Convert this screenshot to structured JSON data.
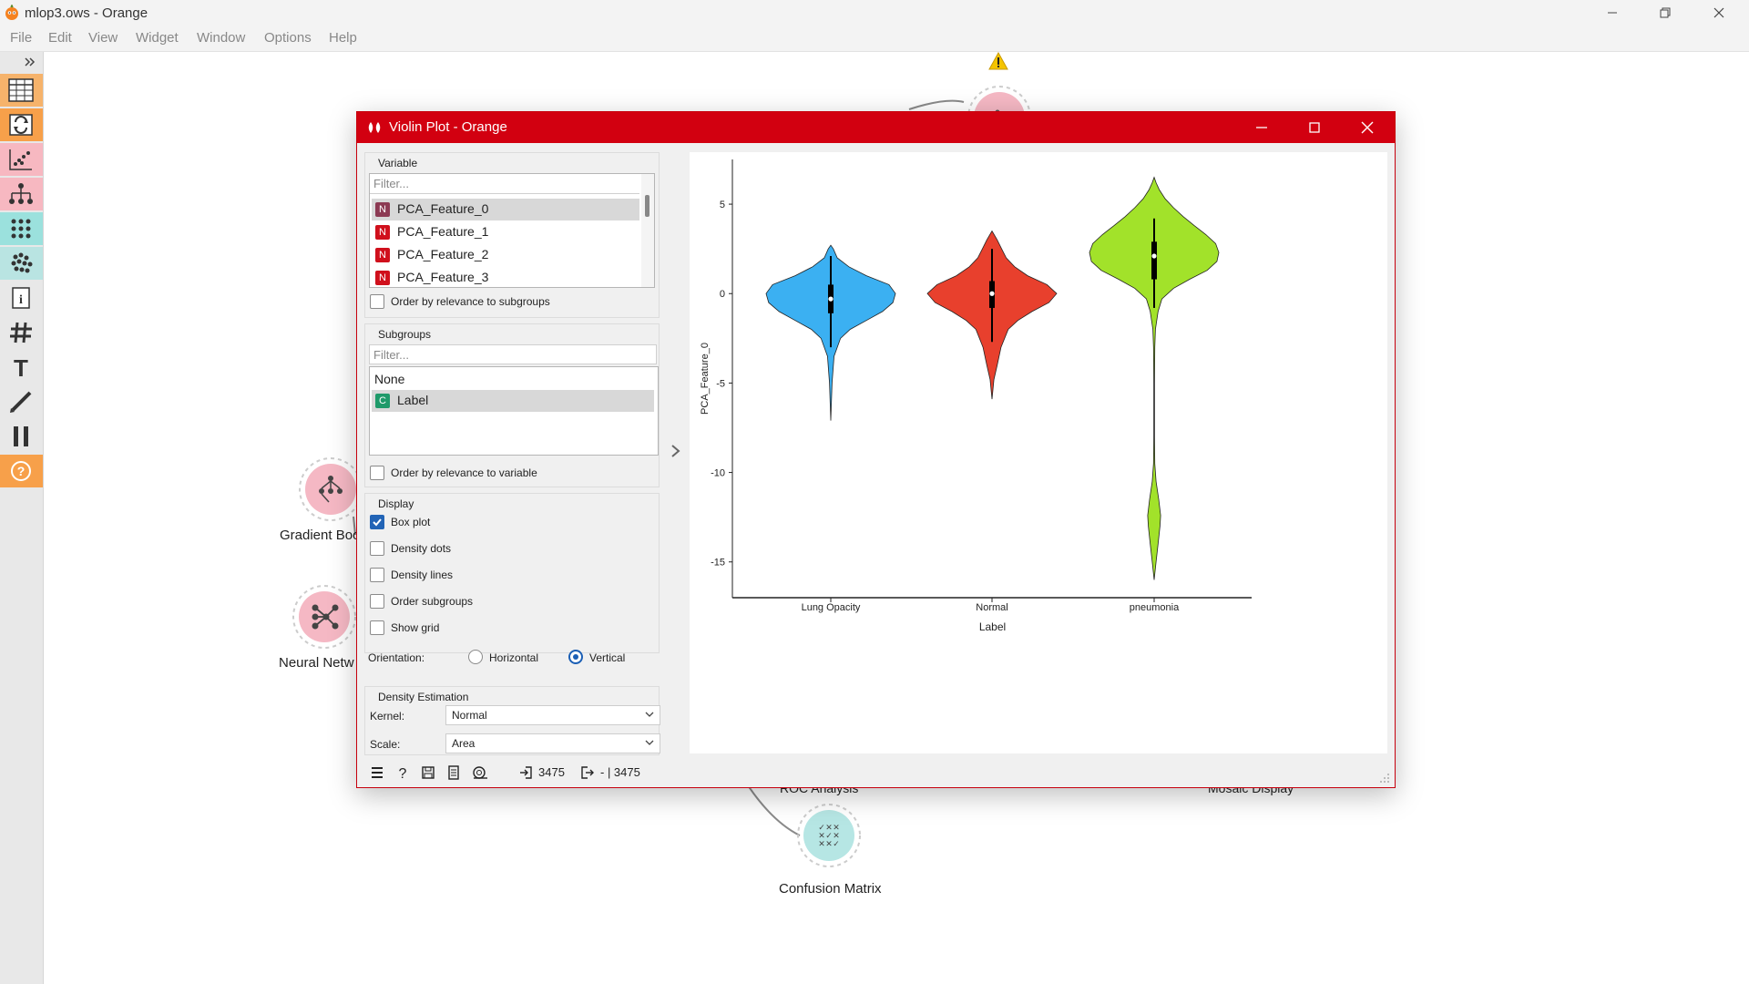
{
  "window": {
    "title": "mlop3.ows - Orange",
    "controls": [
      "minimize-icon",
      "restore-icon",
      "close-icon"
    ]
  },
  "menu": [
    "File",
    "Edit",
    "View",
    "Widget",
    "Window",
    "Options",
    "Help"
  ],
  "toolbox": {
    "items": [
      "expand-icon",
      "table-icon",
      "transform-icon",
      "scatter-icon",
      "tree-icon",
      "matrix-icon",
      "cluster-icon",
      "info-icon",
      "grid-icon",
      "text-icon",
      "pencil-icon",
      "pause-icon",
      "help-icon"
    ]
  },
  "canvas": {
    "nodes": [
      {
        "label": "Gradient Boo",
        "icon": "tree-network-icon"
      },
      {
        "label": "Neural Netw",
        "icon": "neural-network-icon"
      },
      {
        "label": "Confusion Matrix",
        "icon": "confusion-matrix-icon"
      }
    ],
    "partial_labels": [
      "ROC Analysis",
      "Mosaic Display"
    ],
    "warning_icon": "warning-icon"
  },
  "dialog": {
    "title": "Violin Plot - Orange",
    "variable": {
      "group_title": "Variable",
      "filter_placeholder": "Filter...",
      "items": [
        {
          "badge": "N",
          "label": "PCA_Feature_0",
          "selected": true
        },
        {
          "badge": "N",
          "label": "PCA_Feature_1"
        },
        {
          "badge": "N",
          "label": "PCA_Feature_2"
        },
        {
          "badge": "N",
          "label": "PCA_Feature_3"
        }
      ],
      "order_label": "Order by relevance to subgroups"
    },
    "subgroups": {
      "group_title": "Subgroups",
      "filter_placeholder": "Filter...",
      "items": [
        {
          "label": "None"
        },
        {
          "badge": "C",
          "label": "Label",
          "selected": true
        }
      ],
      "order_label": "Order by relevance to variable"
    },
    "display": {
      "group_title": "Display",
      "options": [
        {
          "label": "Box plot",
          "checked": true
        },
        {
          "label": "Density dots",
          "checked": false
        },
        {
          "label": "Density lines",
          "checked": false
        },
        {
          "label": "Order subgroups",
          "checked": false
        },
        {
          "label": "Show grid",
          "checked": false
        }
      ],
      "orientation_label": "Orientation:",
      "horizontal_label": "Horizontal",
      "vertical_label": "Vertical",
      "orientation": "Vertical"
    },
    "density": {
      "group_title": "Density Estimation",
      "kernel_label": "Kernel:",
      "kernel_value": "Normal",
      "scale_label": "Scale:",
      "scale_value": "Area"
    },
    "status": {
      "input_count": "3475",
      "output_text": "- | 3475"
    }
  },
  "chart_data": {
    "type": "violin",
    "orientation": "vertical",
    "xlabel": "Label",
    "ylabel": "PCA_Feature_0",
    "ylim": [
      -17,
      7.5
    ],
    "yticks": [
      5,
      0,
      -5,
      -10,
      -15
    ],
    "grid": false,
    "groups": [
      {
        "name": "Lung Opacity",
        "color": "#3bb0f2",
        "min": -7.1,
        "max": 2.7,
        "q1": -1.1,
        "median": -0.3,
        "q3": 0.5,
        "whisker_low": -3.0,
        "whisker_high": 2.1,
        "profile": [
          [
            -7.1,
            0.0
          ],
          [
            -5.0,
            0.02
          ],
          [
            -3.5,
            0.05
          ],
          [
            -2.5,
            0.15
          ],
          [
            -2.0,
            0.3
          ],
          [
            -1.5,
            0.55
          ],
          [
            -1.0,
            0.8
          ],
          [
            -0.5,
            0.96
          ],
          [
            0.0,
            1.0
          ],
          [
            0.5,
            0.9
          ],
          [
            1.0,
            0.55
          ],
          [
            1.5,
            0.28
          ],
          [
            2.0,
            0.1
          ],
          [
            2.5,
            0.04
          ],
          [
            2.7,
            0.0
          ]
        ]
      },
      {
        "name": "Normal",
        "color": "#e8402d",
        "min": -5.9,
        "max": 3.5,
        "q1": -0.8,
        "median": 0.0,
        "q3": 0.7,
        "whisker_low": -2.7,
        "whisker_high": 2.5,
        "profile": [
          [
            -5.9,
            0.0
          ],
          [
            -4.8,
            0.03
          ],
          [
            -4.0,
            0.08
          ],
          [
            -3.0,
            0.14
          ],
          [
            -2.0,
            0.25
          ],
          [
            -1.5,
            0.4
          ],
          [
            -1.0,
            0.62
          ],
          [
            -0.5,
            0.88
          ],
          [
            0.0,
            1.0
          ],
          [
            0.5,
            0.85
          ],
          [
            1.0,
            0.55
          ],
          [
            1.5,
            0.35
          ],
          [
            2.0,
            0.22
          ],
          [
            2.5,
            0.15
          ],
          [
            3.0,
            0.08
          ],
          [
            3.5,
            0.0
          ]
        ]
      },
      {
        "name": "pneumonia",
        "color": "#a2e22a",
        "min": -16.0,
        "max": 6.5,
        "q1": 0.8,
        "median": 2.1,
        "q3": 2.9,
        "whisker_low": -0.8,
        "whisker_high": 4.2,
        "profile": [
          [
            -16.0,
            0.0
          ],
          [
            -15.0,
            0.03
          ],
          [
            -14.0,
            0.06
          ],
          [
            -13.0,
            0.09
          ],
          [
            -12.4,
            0.1
          ],
          [
            -11.5,
            0.07
          ],
          [
            -10.5,
            0.03
          ],
          [
            -9.5,
            0.01
          ],
          [
            -8.0,
            0.005
          ],
          [
            -5.0,
            0.005
          ],
          [
            -3.0,
            0.01
          ],
          [
            -2.0,
            0.02
          ],
          [
            -1.0,
            0.06
          ],
          [
            -0.3,
            0.12
          ],
          [
            0.3,
            0.3
          ],
          [
            0.8,
            0.55
          ],
          [
            1.3,
            0.82
          ],
          [
            1.8,
            0.97
          ],
          [
            2.3,
            1.0
          ],
          [
            2.8,
            0.95
          ],
          [
            3.3,
            0.8
          ],
          [
            3.8,
            0.62
          ],
          [
            4.3,
            0.45
          ],
          [
            4.8,
            0.3
          ],
          [
            5.3,
            0.17
          ],
          [
            5.8,
            0.08
          ],
          [
            6.2,
            0.03
          ],
          [
            6.5,
            0.0
          ]
        ]
      }
    ]
  }
}
